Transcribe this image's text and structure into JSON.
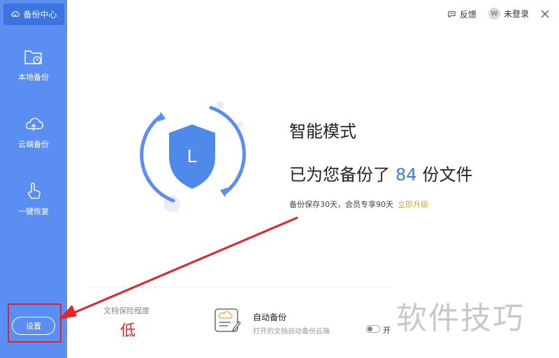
{
  "sidebar": {
    "header_label": "备份中心",
    "header_icon": "cloud-home-icon",
    "items": [
      {
        "label": "本地备份",
        "icon": "folder-clock-icon"
      },
      {
        "label": "云端备份",
        "icon": "cloud-upload-icon"
      },
      {
        "label": "一键恢复",
        "icon": "hand-pointer-icon"
      }
    ],
    "settings_label": "设置"
  },
  "topbar": {
    "feedback_label": "反馈",
    "login_label": "未登录",
    "avatar_letter": "W"
  },
  "main": {
    "mode_title": "智能模式",
    "backup_prefix": "已为您备份了",
    "backup_count": "84",
    "backup_suffix": "份文件",
    "retention_text": "备份保存30天，会员专享90天",
    "upgrade_link": "立即升级",
    "shield_letter": "L"
  },
  "bottom": {
    "protection_label": "文档保险程度",
    "protection_value": "低",
    "auto_backup_title": "自动备份",
    "auto_backup_desc": "打开的文档自动备份云端",
    "toggle_label": "开"
  },
  "watermark": "软件技巧",
  "colors": {
    "sidebar": "#5a8ef3",
    "sidebar_active": "#3d73dc",
    "accent_blue": "#3d7bd8",
    "upgrade": "#d6a33b",
    "protection_low": "#c9302c",
    "annotation_red": "#e5212b"
  }
}
